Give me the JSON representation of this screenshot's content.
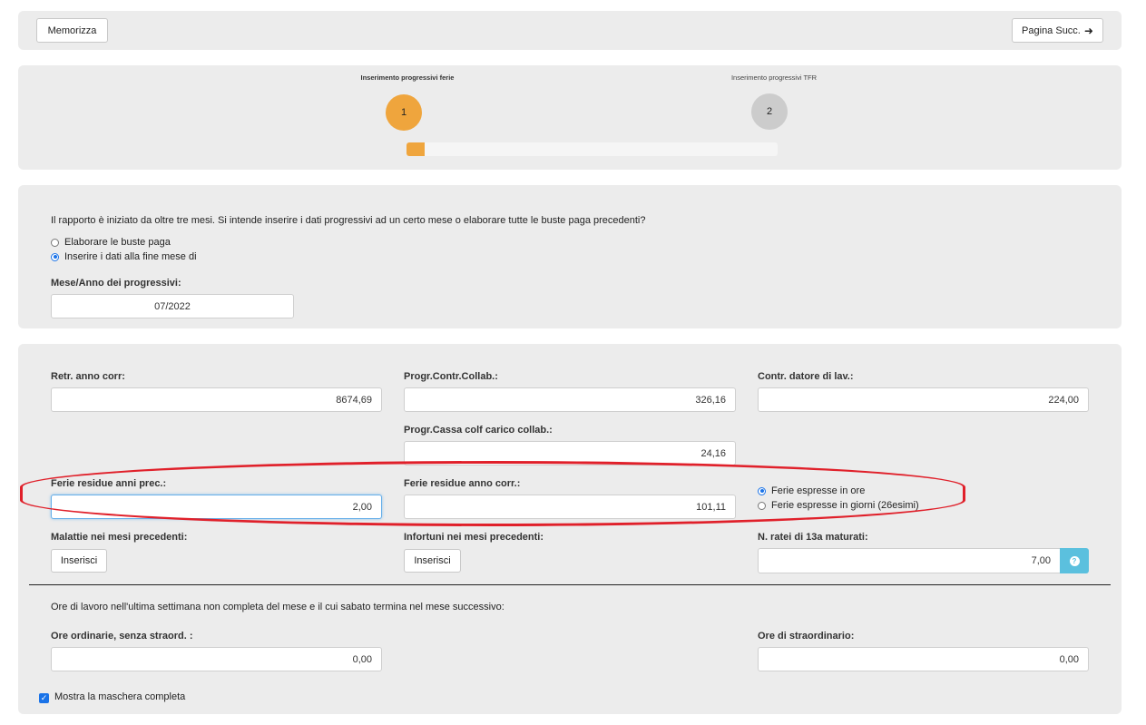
{
  "toolbar": {
    "save_label": "Memorizza",
    "next_label": "Pagina Succ.",
    "next_icon": "arrow-right-icon"
  },
  "wizard": {
    "steps": [
      {
        "label": "Inserimento progressivi ferie",
        "number": "1",
        "active": true
      },
      {
        "label": "Inserimento progressivi TFR",
        "number": "2",
        "active": false
      }
    ],
    "progress_fraction": 0.05,
    "colors": {
      "active": "#efa53d",
      "inactive": "#cccccc"
    }
  },
  "intro": {
    "question": "Il rapporto è iniziato da oltre tre mesi. Si intende inserire i dati progressivi ad un certo mese o elaborare tutte le buste paga precedenti?",
    "options": [
      {
        "label": "Elaborare le buste paga",
        "selected": false
      },
      {
        "label": "Inserire i dati alla fine mese di",
        "selected": true
      }
    ],
    "month_label": "Mese/Anno dei progressivi:",
    "month_value": "07/2022"
  },
  "fields": {
    "retr_label": "Retr. anno corr:",
    "retr_value": "8674,69",
    "contr_collab_label": "Progr.Contr.Collab.:",
    "contr_collab_value": "326,16",
    "contr_datore_label": "Contr. datore di lav.:",
    "contr_datore_value": "224,00",
    "cassa_label": "Progr.Cassa colf carico collab.:",
    "cassa_value": "24,16",
    "ferie_prec_label": "Ferie residue anni prec.:",
    "ferie_prec_value": "2,00",
    "ferie_corr_label": "Ferie residue anno corr.:",
    "ferie_corr_value": "101,11",
    "ferie_unit_options": [
      {
        "label": "Ferie espresse in ore",
        "selected": true
      },
      {
        "label": "Ferie espresse in giorni (26esimi)",
        "selected": false
      }
    ],
    "malattie_label": "Malattie nei mesi precedenti:",
    "malattie_button": "Inserisci",
    "infortuni_label": "Infortuni nei mesi precedenti:",
    "infortuni_button": "Inserisci",
    "ratei_label": "N. ratei di 13a maturati:",
    "ratei_value": "7,00",
    "ratei_help_icon": "question-circle-icon"
  },
  "last_week": {
    "note": "Ore di lavoro nell'ultima settimana non completa del mese e il cui sabato termina nel mese successivo:",
    "ordinarie_label": "Ore ordinarie, senza straord. :",
    "ordinarie_value": "0,00",
    "straord_label": "Ore di straordinario:",
    "straord_value": "0,00"
  },
  "footer": {
    "show_full_label": "Mostra la maschera completa",
    "show_full_checked": true
  }
}
